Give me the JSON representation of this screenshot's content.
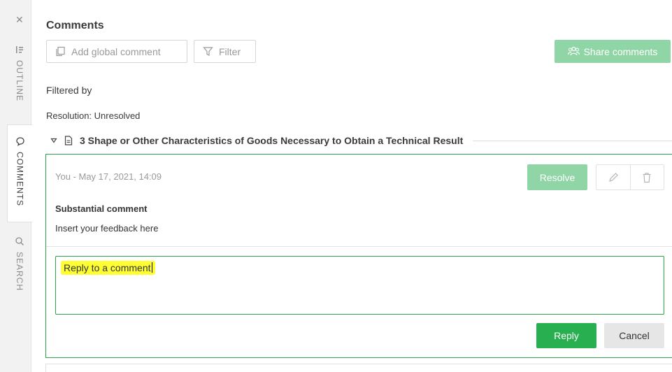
{
  "sidebar": {
    "close_icon": "close-icon",
    "tabs": [
      {
        "label": "OUTLINE",
        "icon": "outline-icon",
        "active": false
      },
      {
        "label": "COMMENTS",
        "icon": "comment-bubble-icon",
        "active": true
      },
      {
        "label": "SEARCH",
        "icon": "search-icon",
        "active": false
      }
    ]
  },
  "header": {
    "title": "Comments",
    "add_global_comment": "Add global comment",
    "filter": "Filter",
    "share_comments": "Share comments"
  },
  "filters": {
    "heading": "Filtered by",
    "resolution": "Resolution: Unresolved"
  },
  "section": {
    "title": "3 Shape or Other Characteristics of Goods Necessary to Obtain a Technical Result"
  },
  "comment": {
    "meta": "You - May 17, 2021, 14:09",
    "resolve_label": "Resolve",
    "type": "Substantial comment",
    "text": "Insert your feedback here",
    "reply_value": "Reply to a comment",
    "reply_label": "Reply",
    "cancel_label": "Cancel"
  },
  "colors": {
    "accent_green": "#28b050",
    "light_green": "#8fd5a6",
    "highlight": "#ffff33"
  }
}
